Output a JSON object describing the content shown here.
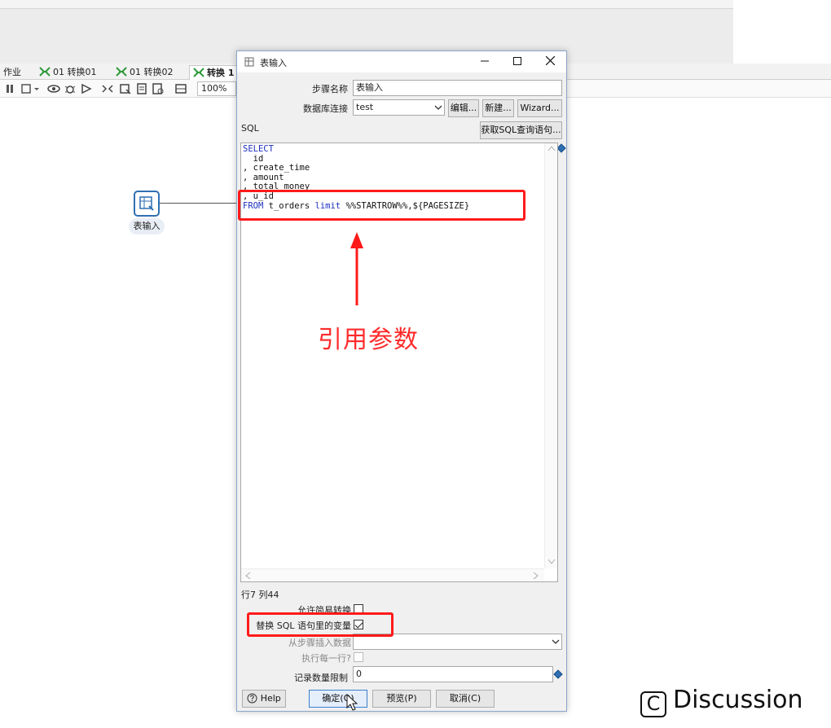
{
  "app": {
    "tabs": [
      {
        "label": "作业"
      },
      {
        "label": "01 转换01"
      },
      {
        "label": "01 转换02"
      },
      {
        "label": "转换 1"
      }
    ],
    "zoom": "100%",
    "canvas_step": {
      "label": "表输入"
    }
  },
  "dialog": {
    "title": "表输入",
    "step_name_label": "步骤名称",
    "step_name_value": "表输入",
    "db_conn_label": "数据库连接",
    "db_conn_value": "test",
    "edit_button": "编辑...",
    "new_button": "新建...",
    "wizard_button": "Wizard...",
    "sql_label": "SQL",
    "get_sql_button": "获取SQL查询语句...",
    "sql_lines": [
      "SELECT",
      "  id",
      ", create_time",
      ", amount",
      ", total_money",
      ", u_id",
      "FROM t_orders limit %%STARTROW%%,${PAGESIZE}"
    ],
    "cursor_pos": "行7 列44",
    "allow_lazy_label": "允许简易转换",
    "allow_lazy_checked": false,
    "replace_vars_label": "替换 SQL 语句里的变量",
    "replace_vars_checked": true,
    "insert_from_label": "从步骤插入数据",
    "insert_from_value": "",
    "exec_each_label": "执行每一行?",
    "exec_each_checked": false,
    "limit_label": "记录数量限制",
    "limit_value": "0",
    "help_button": "Help",
    "ok_button": "确定(O)",
    "preview_button": "预览(P)",
    "cancel_button": "取消(C)"
  },
  "annotation": {
    "text": "引用参数",
    "color": "#ff2a2a"
  },
  "watermark": {
    "icon_letter": "C",
    "text": "Discussion"
  }
}
